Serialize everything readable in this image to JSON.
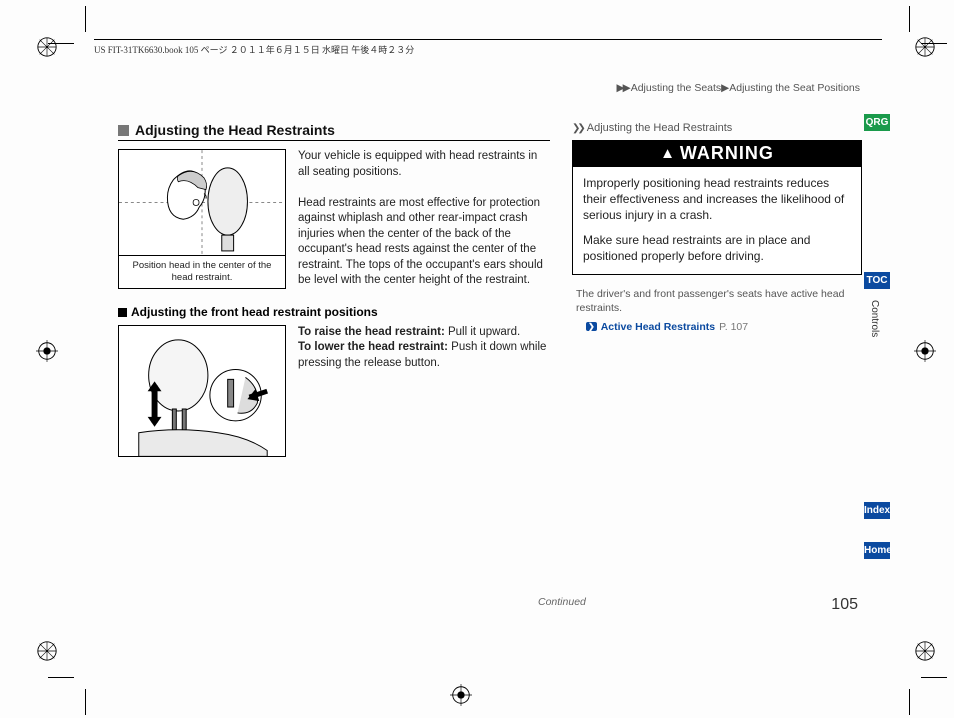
{
  "header_meta": "US FIT-31TK6630.book  105 ページ  ２０１１年６月１５日  水曜日  午後４時２３分",
  "breadcrumb": {
    "arrows": "▶▶",
    "path1": "Adjusting the Seats",
    "sep": "▶",
    "path2": "Adjusting the Seat Positions"
  },
  "section": {
    "title": "Adjusting the Head Restraints",
    "fig1_caption": "Position head in the center of the head restraint.",
    "intro_p1": "Your vehicle is equipped with head restraints in all seating positions.",
    "intro_p2": "Head restraints are most effective for protection against whiplash and other rear-impact crash injuries when the center of the back of the occupant's head rests against the center of the restraint. The tops of the occupant's ears should be level with the center height of the restraint.",
    "sub_title": "Adjusting the front head restraint positions",
    "raise_label": "To raise the head restraint:",
    "raise_text": " Pull it upward.",
    "lower_label": "To lower the head restraint:",
    "lower_text": " Push it down while pressing the release button."
  },
  "right": {
    "note_heading": "Adjusting the Head Restraints",
    "warning_title": "WARNING",
    "warning_p1": "Improperly positioning head restraints reduces their effectiveness and increases the likelihood of serious injury in a crash.",
    "warning_p2": "Make sure head restraints are in place and positioned properly before driving.",
    "sidenote": "The driver's and front passenger's seats have active head restraints.",
    "ref_label": "Active Head Restraints",
    "ref_page": "P. 107"
  },
  "tabs": {
    "qrg": "QRG",
    "toc": "TOC",
    "controls": "Controls",
    "index": "Index",
    "home": "Home"
  },
  "footer": {
    "continued": "Continued",
    "pagenum": "105"
  }
}
